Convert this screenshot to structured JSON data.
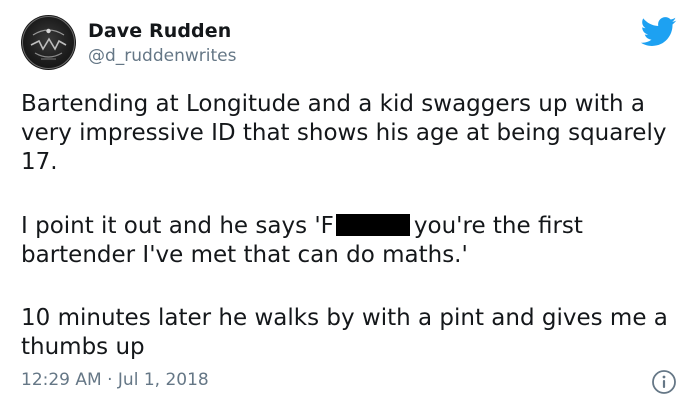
{
  "author": {
    "name": "Dave Rudden",
    "handle": "@d_ruddenwrites"
  },
  "tweet": {
    "paragraph1": "Bartending at Longitude and a kid swaggers up with a very impressive ID that shows his age at being squarely 17.",
    "paragraph2_start": "I point it out and he says 'F",
    "paragraph2_end": "you're the first bartender I've met that can do maths.'",
    "paragraph3": "10 minutes later he walks by with a pint and gives me a thumbs up"
  },
  "timestamp": "12:29 AM · Jul 1, 2018",
  "icons": {
    "brand": "twitter-bird-icon",
    "info": "info-icon"
  },
  "colors": {
    "brand": "#1da1f2",
    "text": "#14171a",
    "secondary": "#657786"
  }
}
